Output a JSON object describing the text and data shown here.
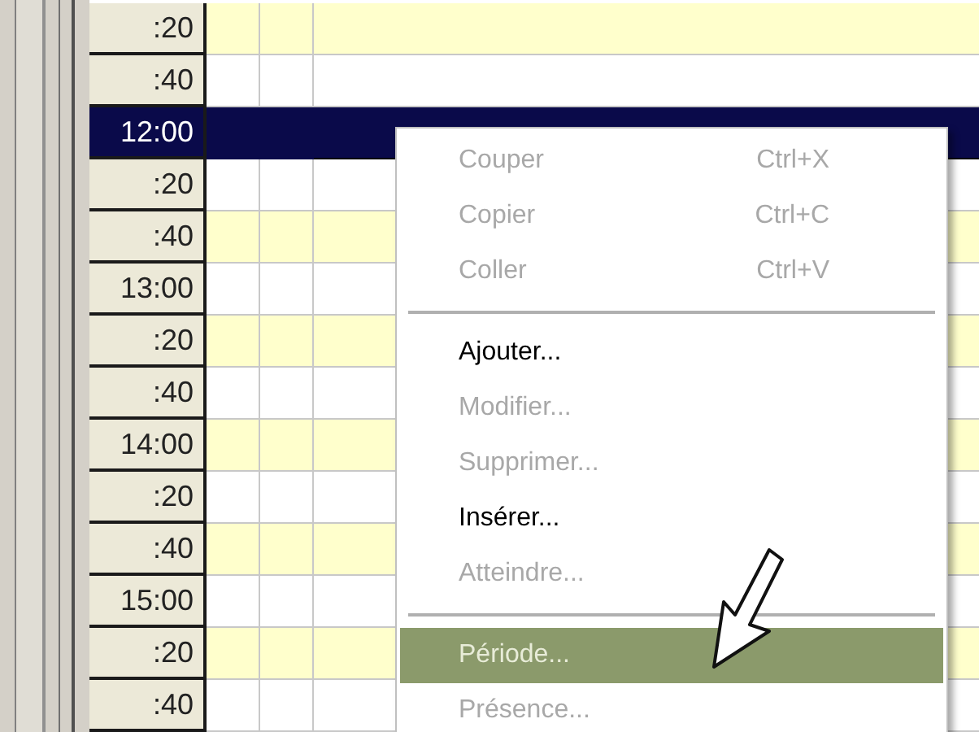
{
  "time_rows": [
    {
      "label": ":20",
      "shaded": true,
      "selected": false
    },
    {
      "label": ":40",
      "shaded": false,
      "selected": false
    },
    {
      "label": "12:00",
      "selected": true
    },
    {
      "label": ":20",
      "shaded": false,
      "selected": false
    },
    {
      "label": ":40",
      "shaded": true,
      "selected": false
    },
    {
      "label": "13:00",
      "shaded": false,
      "selected": false
    },
    {
      "label": ":20",
      "shaded": true,
      "selected": false
    },
    {
      "label": ":40",
      "shaded": false,
      "selected": false
    },
    {
      "label": "14:00",
      "shaded": true,
      "selected": false
    },
    {
      "label": ":20",
      "shaded": false,
      "selected": false
    },
    {
      "label": ":40",
      "shaded": true,
      "selected": false
    },
    {
      "label": "15:00",
      "shaded": false,
      "selected": false
    },
    {
      "label": ":20",
      "shaded": true,
      "selected": false
    },
    {
      "label": ":40",
      "shaded": false,
      "selected": false
    }
  ],
  "context_menu": [
    {
      "kind": "item",
      "label": "Couper",
      "shortcut": "Ctrl+X",
      "disabled": true,
      "selected": false
    },
    {
      "kind": "item",
      "label": "Copier",
      "shortcut": "Ctrl+C",
      "disabled": true,
      "selected": false
    },
    {
      "kind": "item",
      "label": "Coller",
      "shortcut": "Ctrl+V",
      "disabled": true,
      "selected": false
    },
    {
      "kind": "separator"
    },
    {
      "kind": "item",
      "label": "Ajouter...",
      "disabled": false,
      "selected": false
    },
    {
      "kind": "item",
      "label": "Modifier...",
      "disabled": true,
      "selected": false
    },
    {
      "kind": "item",
      "label": "Supprimer...",
      "disabled": true,
      "selected": false
    },
    {
      "kind": "item",
      "label": "Insérer...",
      "disabled": false,
      "selected": false
    },
    {
      "kind": "item",
      "label": "Atteindre...",
      "disabled": true,
      "selected": false
    },
    {
      "kind": "separator"
    },
    {
      "kind": "item",
      "label": "Période...",
      "disabled": true,
      "selected": true
    },
    {
      "kind": "item",
      "label": "Présence...",
      "disabled": true,
      "selected": false
    }
  ]
}
